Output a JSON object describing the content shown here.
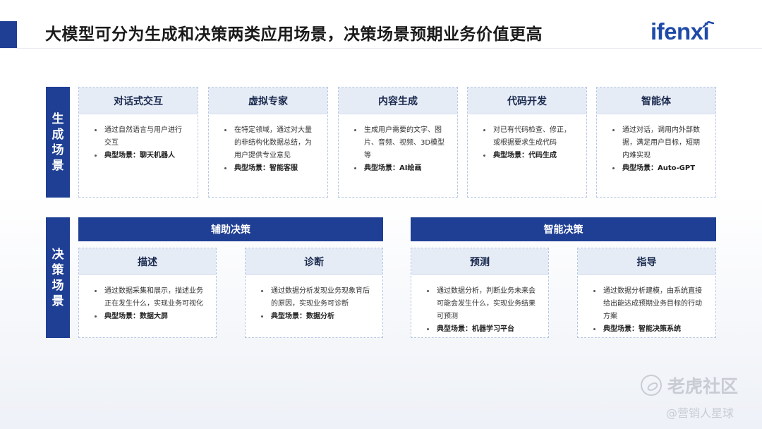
{
  "header": {
    "title": "大模型可分为生成和决策两类应用场景，决策场景预期业务价值更高",
    "logo": "ifenxi",
    "accent_color": "#1f3f94",
    "logo_color": "#1f4aa8"
  },
  "generation": {
    "side_label": [
      "生",
      "成",
      "场",
      "景"
    ],
    "cards": [
      {
        "title": "对话式交互",
        "bullets": [
          "通过自然语言与用户进行交互"
        ],
        "example": "典型场景：聊天机器人"
      },
      {
        "title": "虚拟专家",
        "bullets": [
          "在特定领域，通过对大量的非结构化数据总结，为用户提供专业意见"
        ],
        "example": "典型场景：智能客服"
      },
      {
        "title": "内容生成",
        "bullets": [
          "生成用户需要的文字、图片、音频、视频、3D模型等"
        ],
        "example": "典型场景：AI绘画"
      },
      {
        "title": "代码开发",
        "bullets": [
          "对已有代码检查、修正，或根据要求生成代码"
        ],
        "example": "典型场景：代码生成"
      },
      {
        "title": "智能体",
        "bullets": [
          "通过对话，调用内外部数据，满足用户目标，短期内难实现"
        ],
        "example": "典型场景：Auto-GPT"
      }
    ]
  },
  "decision": {
    "side_label": [
      "决",
      "策",
      "场",
      "景"
    ],
    "groups": [
      {
        "label": "辅助决策"
      },
      {
        "label": "智能决策"
      }
    ],
    "cards": [
      {
        "title": "描述",
        "bullets": [
          "通过数据采集和展示，描述业务正在发生什么，实现业务可视化"
        ],
        "example": "典型场景：数据大屏"
      },
      {
        "title": "诊断",
        "bullets": [
          "通过数据分析发现业务现象背后的原因，实现业务可诊断"
        ],
        "example": "典型场景：数据分析"
      },
      {
        "title": "预测",
        "bullets": [
          "通过数据分析，判断业务未来会可能会发生什么，实现业务结果可预测"
        ],
        "example": "典型场景：机器学习平台"
      },
      {
        "title": "指导",
        "bullets": [
          "通过数据分析建模，由系统直接给出能达成预期业务目标的行动方案"
        ],
        "example": "典型场景：智能决策系统"
      }
    ]
  },
  "watermark": {
    "brand": "老虎社区",
    "handle": "@营销人星球"
  }
}
